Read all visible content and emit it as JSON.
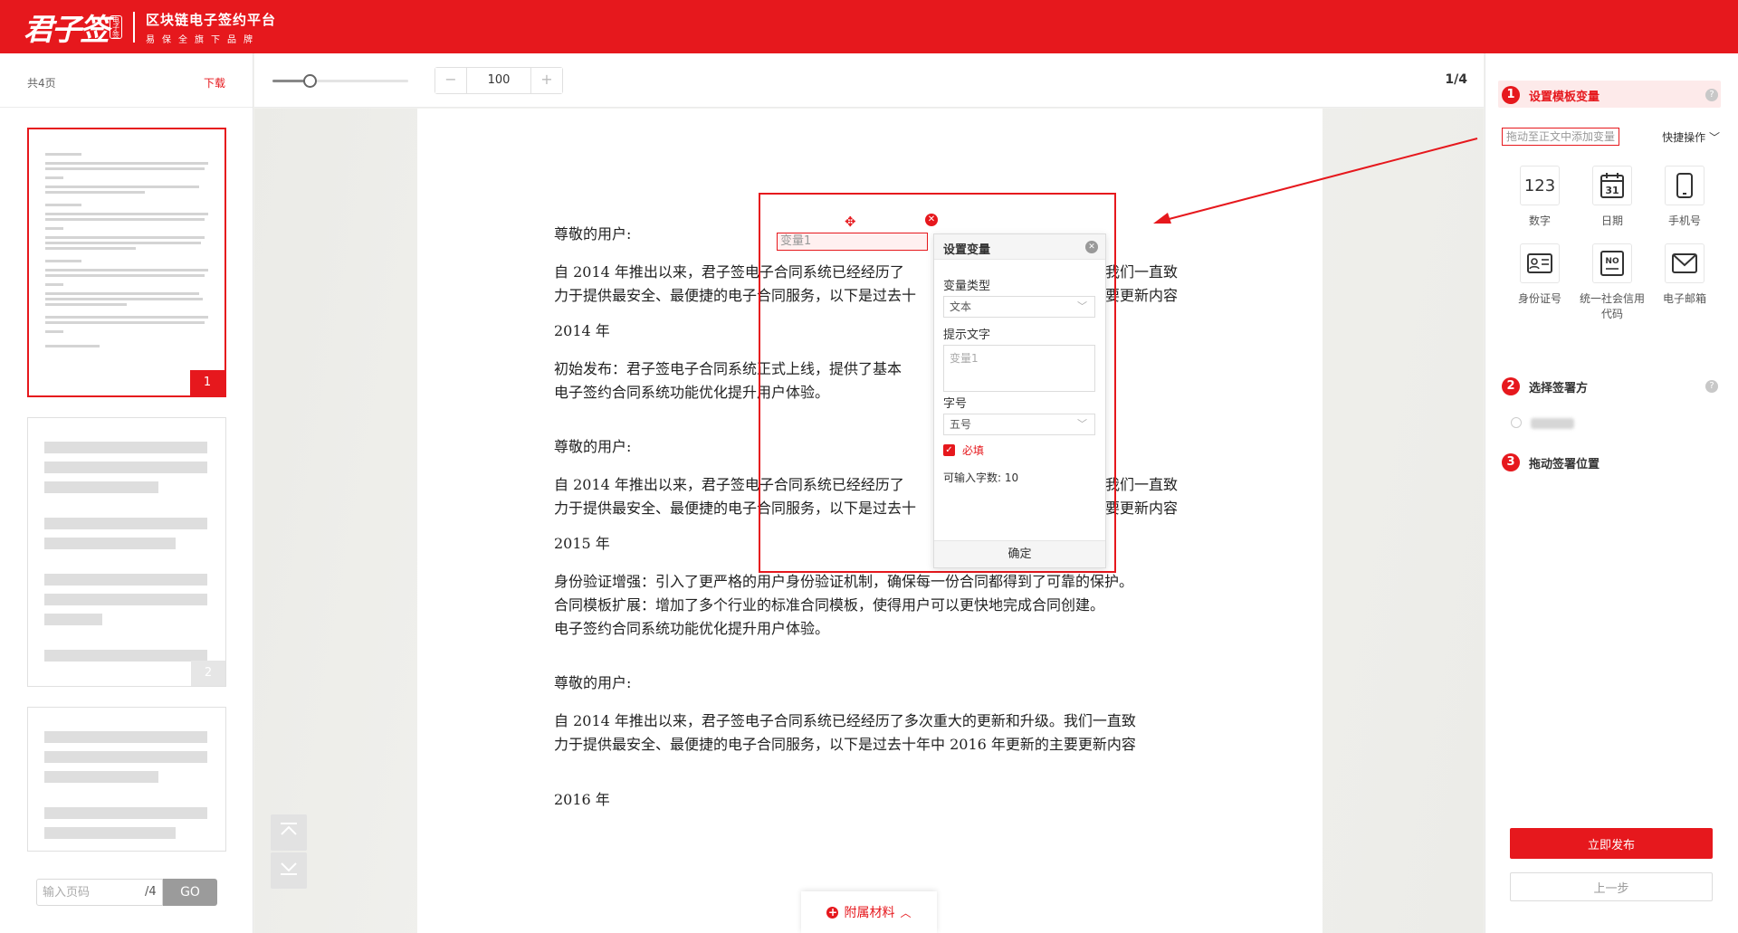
{
  "header": {
    "logo_main": "君子签",
    "logo_seal": "电子签",
    "platform_title": "区块链电子签约平台",
    "platform_subtitle": "易保全旗下品牌"
  },
  "left_panel": {
    "page_count": "共4页",
    "download_label": "下载",
    "thumbnails": [
      {
        "num": "1",
        "active": true
      },
      {
        "num": "2",
        "active": false
      },
      {
        "num": "",
        "active": false
      }
    ],
    "pager": {
      "placeholder": "输入页码",
      "total": "/4",
      "go_label": "GO"
    }
  },
  "toolbar": {
    "zoom_slider_level": 0.27,
    "zoom_minus": "−",
    "zoom_value": "100",
    "zoom_plus": "+",
    "page_indicator": "1/4"
  },
  "document": {
    "paragraphs": [
      "尊敬的用户:",
      "自 2014 年推出以来，君子签电子合同系统已经经历了",
      "力于提供最安全、最便捷的电子合同服务，以下是过去十",
      "2014 年",
      "初始发布：君子签电子合同系统正式上线，提供了基本",
      "电子签约合同系统功能优化提升用户体验。",
      "尊敬的用户:",
      "自 2014 年推出以来，君子签电子合同系统已经经历了",
      "力于提供最安全、最便捷的电子合同服务，以下是过去十",
      "2015 年",
      "身份验证增强：引入了更严格的用户身份验证机制，确保每一份合同都得到了可靠的保护。",
      "合同模板扩展：增加了多个行业的标准合同模板，使得用户可以更快地完成合同创建。",
      "电子签约合同系统功能优化提升用户体验。",
      "尊敬的用户:",
      "自 2014 年推出以来，君子签电子合同系统已经经历了多次重大的更新和升级。我们一直致",
      "力于提供最安全、最便捷的电子合同服务，以下是过去十年中 2016 年更新的主要更新内容",
      "2016 年"
    ],
    "right_fragments": [
      "我们一直致",
      "要更新内容",
      "我们一直致",
      "要更新内容"
    ]
  },
  "variable_box": {
    "field_value": "变量1",
    "move_icon": "move-icon",
    "dialog": {
      "title": "设置变量",
      "type_label": "变量类型",
      "type_value": "文本",
      "prompt_label": "提示文字",
      "prompt_value": "变量1",
      "font_size_label": "字号",
      "font_size_value": "五号",
      "required_label": "必填",
      "required_checked": true,
      "max_chars_label": "可输入字数: 10",
      "confirm_label": "确定"
    }
  },
  "attachments": {
    "label": "附属材料"
  },
  "right_panel": {
    "step1": {
      "num": "1",
      "label": "设置模板变量"
    },
    "drag_hint": "拖动至正文中添加变量",
    "quick_actions": "快捷操作",
    "variable_types": [
      {
        "glyph": "123",
        "label": "数字",
        "icon": "number-icon"
      },
      {
        "glyph": "31",
        "label": "日期",
        "icon": "calendar-icon"
      },
      {
        "glyph": "▯",
        "label": "手机号",
        "icon": "phone-icon"
      },
      {
        "glyph": "▤",
        "label": "身份证号",
        "icon": "id-card-icon"
      },
      {
        "glyph": "NO",
        "label": "统一社会信用代码",
        "icon": "credit-code-icon"
      },
      {
        "glyph": "✉",
        "label": "电子邮箱",
        "icon": "email-icon"
      }
    ],
    "step2": {
      "num": "2",
      "label": "选择签署方"
    },
    "step3": {
      "num": "3",
      "label": "拖动签署位置"
    },
    "publish_label": "立即发布",
    "prev_label": "上一步"
  },
  "colors": {
    "brand_red": "#e6181d"
  }
}
